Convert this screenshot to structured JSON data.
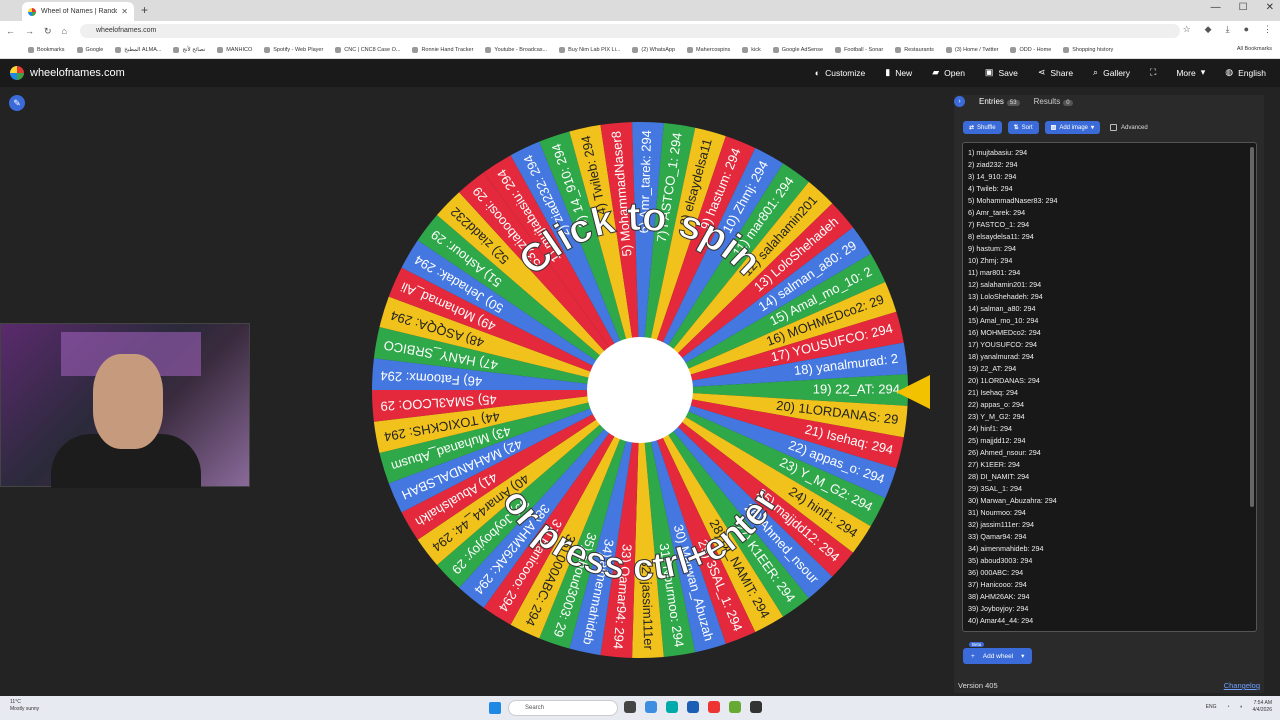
{
  "browser": {
    "tab_title": "Wheel of Names | Random",
    "url": "wheelofnames.com",
    "bookmarks": [
      "Bookmarks",
      "Google",
      "المطبخ ALMA...",
      "نصائح لأنج",
      "MANHICO",
      "Spotify - Web Player",
      "CNC | CNC8 Case O...",
      "Ronnie Hand Tracker",
      "Youtube - Broadcas...",
      "Buy Nim Lab PIX Li...",
      "(2) WhatsApp",
      "Mahercospins",
      "kick",
      "Google AdSense",
      "Football - Sonar",
      "Restaurants",
      "(3) Home / Twitter",
      "ODD - Home",
      "Shopping history"
    ],
    "all_bookmarks": "All Bookmarks"
  },
  "app": {
    "brand": "wheelofnames.com",
    "menu": [
      "Customize",
      "New",
      "Open",
      "Save",
      "Share",
      "Gallery",
      "More",
      "English"
    ]
  },
  "wheel": {
    "center_text_top": "Click to spin",
    "center_text_bottom": "or press ctrl+enter",
    "colors": [
      "#e3293b",
      "#4478e0",
      "#2fa84a",
      "#f1c21b"
    ],
    "pointer_color": "#f2c200"
  },
  "panel": {
    "tab_entries": "Entries",
    "entries_count": "53",
    "tab_results": "Results",
    "results_count": "0",
    "shuffle": "Shuffle",
    "sort": "Sort",
    "add_image": "Add image",
    "advanced": "Advanced",
    "add_wheel": "Add wheel",
    "beta": "Beta",
    "version": "Version 405",
    "changelog": "Changelog"
  },
  "entries": [
    "1) mujtabasiu: 294",
    "2) ziad232: 294",
    "3) 14_910: 294",
    "4) Twileb: 294",
    "5) MohammadNaser83: 294",
    "6) Amr_tarek: 294",
    "7) FASTCO_1: 294",
    "8) elsaydelsa11: 294",
    "9) hastum: 294",
    "10) Zhmj: 294",
    "11) mar801: 294",
    "12) salahamin201: 294",
    "13) LoloShehadeh: 294",
    "14) salman_a80: 294",
    "15) Amal_mo_10: 294",
    "16) MOHMEDco2: 294",
    "17) YOUSUFCO: 294",
    "18) yanalmurad: 294",
    "19) 22_AT: 294",
    "20) 1LORDANAS: 294",
    "21) Isehaq: 294",
    "22) appas_o: 294",
    "23) Y_M_G2: 294",
    "24) hinf1: 294",
    "25) majjdd12: 294",
    "26) Ahmed_nsour: 294",
    "27) K1EER: 294",
    "28) DI_NAMIT: 294",
    "29) 3SAL_1: 294",
    "30) Marwan_Abuzahra: 294",
    "31) Nourmoo: 294",
    "32) jassim111er: 294",
    "33) Qamar94: 294",
    "34) aimenmahideb: 294",
    "35) aboud3003: 294",
    "36) 000ABC: 294",
    "37) Hanicooo: 294",
    "38) AHM26AK: 294",
    "39) Joyboyjoy: 294",
    "40) Amar44_44: 294"
  ],
  "wheel_labels": [
    "1) mujtabasiu: 294",
    "2) ziad232: 294",
    "3) 14_910: 294",
    "4) Twileb: 294",
    "5) MohammadNaser8",
    "6) Amr_tarek: 294",
    "7) FASTCO_1: 294",
    "8) elsaydelsa11",
    "9) hastum: 294",
    "10) Zhmj: 294",
    "11) mar801: 294",
    "12) salahamin201",
    "13) LoloShehadeh",
    "14) salman_a80: 29",
    "15) Amal_mo_10: 2",
    "16) MOHMEDco2: 29",
    "17) YOUSUFCO: 294",
    "18) yanalmurad: 2",
    "19) 22_AT: 294",
    "20) 1LORDANAS: 29",
    "21) Isehaq: 294",
    "22) appas_o: 294",
    "23) Y_M_G2: 294",
    "24) hinf1: 294",
    "25) majjdd12: 294",
    "26) Ahmed_nsour",
    "27) K1EER: 294",
    "28) DI_NAMIT: 294",
    "29) 3SAL_1: 294",
    "30) Marwan_Abuzah",
    "31) Nourmoo: 294",
    "32) jassim111er",
    "33) Qamar94: 294",
    "34) aimenmahideb",
    "35) aboud3003: 29",
    "36) 000ABC: 294",
    "37) Hanicooo: 294",
    "38) AHM26AK: 294",
    "39) Joyboyjoy: 29",
    "40) Amar44_44: 294",
    "41) Abualshaikh",
    "42) MAHANDALSBAH",
    "43) Muhanad_Abusm",
    "44) TOXICKHS: 294",
    "45) SMA3LCOO: 29",
    "46) Fatoomx: 294",
    "47) HANY_SRBICO",
    "48) ASQQA: 294",
    "49) Mohamad_Ali",
    "50) Jehadak: 294",
    "51) Ashour: 29",
    "52) ziadd232",
    "53) ziabooosi: 29"
  ],
  "taskbar": {
    "temp": "11°C",
    "weather": "Mostly sunny",
    "search": "Search",
    "lang": "ENG",
    "time": "7:54 AM",
    "date": "4/4/2026"
  }
}
